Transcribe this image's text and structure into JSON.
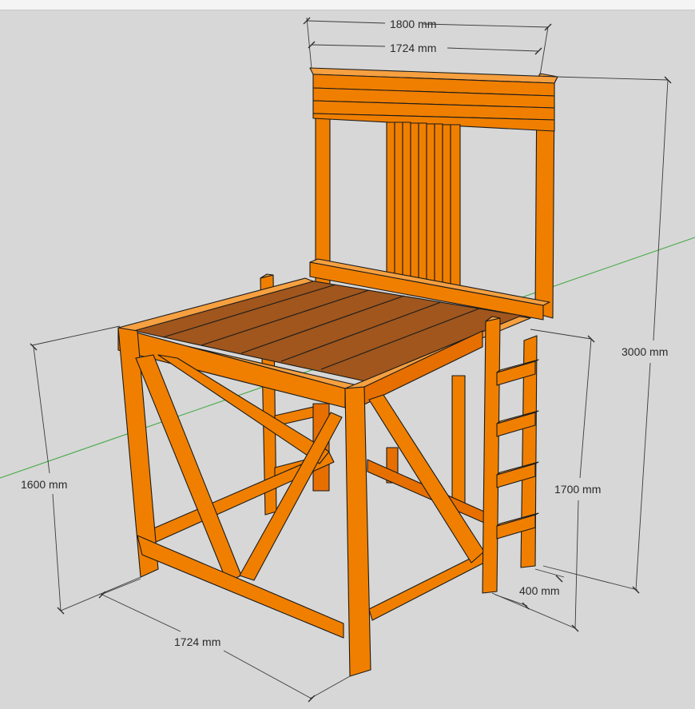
{
  "colors": {
    "background": "#d7d7d7",
    "wood_front": "#f07f00",
    "wood_side": "#e66f00",
    "wood_top": "#f6a040",
    "deck": "#a0561d",
    "axis_green": "#3aa63a",
    "dimension_line": "#3a3a3a"
  },
  "dimensions": {
    "top_width_outer": "1800 mm",
    "top_width_inner": "1724 mm",
    "total_height": "3000 mm",
    "platform_height": "1600 mm",
    "ladder_height": "1700 mm",
    "ladder_width": "400 mm",
    "base_depth": "1724 mm"
  }
}
